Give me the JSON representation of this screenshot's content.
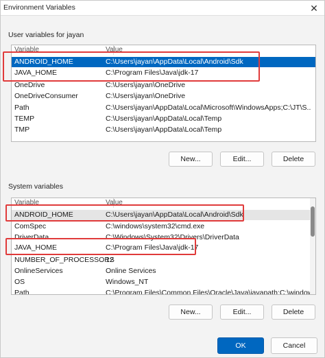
{
  "window": {
    "title": "Environment Variables",
    "close_glyph": "✕"
  },
  "user_vars": {
    "group_label": "User variables for jayan",
    "columns": {
      "variable": "Variable",
      "value": "Value"
    },
    "rows": [
      {
        "variable": "ANDROID_HOME",
        "value": "C:\\Users\\jayan\\AppData\\Local\\Android\\Sdk"
      },
      {
        "variable": "JAVA_HOME",
        "value": "C:\\Program Files\\Java\\jdk-17"
      },
      {
        "variable": "OneDrive",
        "value": "C:\\Users\\jayan\\OneDrive"
      },
      {
        "variable": "OneDriveConsumer",
        "value": "C:\\Users\\jayan\\OneDrive"
      },
      {
        "variable": "Path",
        "value": "C:\\Users\\jayan\\AppData\\Local\\Microsoft\\WindowsApps;C:\\JT\\S..."
      },
      {
        "variable": "TEMP",
        "value": "C:\\Users\\jayan\\AppData\\Local\\Temp"
      },
      {
        "variable": "TMP",
        "value": "C:\\Users\\jayan\\AppData\\Local\\Temp"
      }
    ],
    "buttons": {
      "new": "New...",
      "edit": "Edit...",
      "delete": "Delete"
    }
  },
  "system_vars": {
    "group_label": "System variables",
    "columns": {
      "variable": "Variable",
      "value": "Value"
    },
    "rows": [
      {
        "variable": "ANDROID_HOME",
        "value": "C:\\Users\\jayan\\AppData\\Local\\Android\\Sdk"
      },
      {
        "variable": "ComSpec",
        "value": "C:\\windows\\system32\\cmd.exe"
      },
      {
        "variable": "DriverData",
        "value": "C:\\Windows\\System32\\Drivers\\DriverData"
      },
      {
        "variable": "JAVA_HOME",
        "value": "C:\\Program Files\\Java\\jdk-17"
      },
      {
        "variable": "NUMBER_OF_PROCESSORS",
        "value": "12"
      },
      {
        "variable": "OnlineServices",
        "value": "Online Services"
      },
      {
        "variable": "OS",
        "value": "Windows_NT"
      },
      {
        "variable": "Path",
        "value": "C:\\Program Files\\Common Files\\Oracle\\Java\\javapath;C:\\window..."
      }
    ],
    "buttons": {
      "new": "New...",
      "edit": "Edit...",
      "delete": "Delete"
    }
  },
  "footer": {
    "ok": "OK",
    "cancel": "Cancel"
  },
  "colors": {
    "selection": "#0067c0",
    "highlight": "#e03a3a"
  }
}
